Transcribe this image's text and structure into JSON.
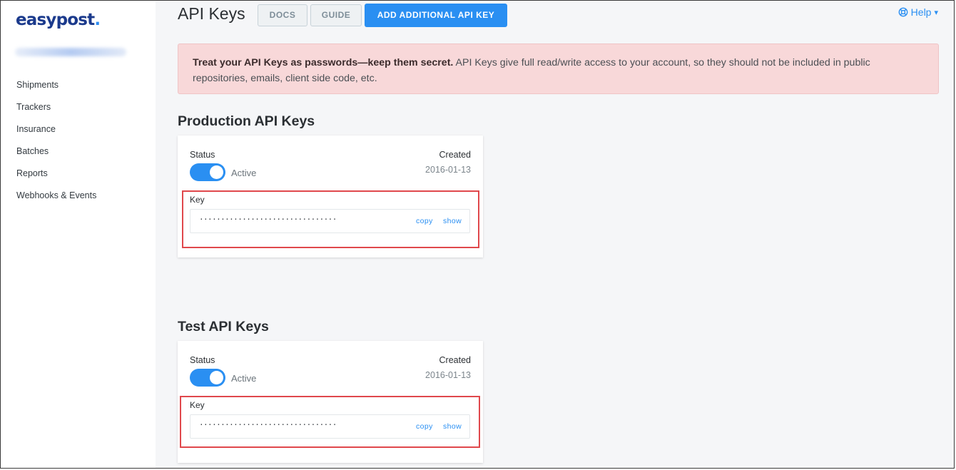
{
  "brand": {
    "logo_text": "easypost",
    "logo_dot": "."
  },
  "sidebar": {
    "items": [
      {
        "label": "Shipments"
      },
      {
        "label": "Trackers"
      },
      {
        "label": "Insurance"
      },
      {
        "label": "Batches"
      },
      {
        "label": "Reports"
      },
      {
        "label": "Webhooks & Events"
      }
    ]
  },
  "header": {
    "title": "API Keys",
    "docs_label": "DOCS",
    "guide_label": "GUIDE",
    "add_label": "ADD ADDITIONAL API KEY",
    "help_label": "Help",
    "help_caret": "▾"
  },
  "alert": {
    "strong": "Treat your API Keys as passwords—keep them secret.",
    "text": " API Keys give full read/write access to your account, so they should not be included in public repositories, emails, client side code, etc."
  },
  "production": {
    "title": "Production API Keys",
    "status_label": "Status",
    "status_value": "Active",
    "toggle_on": true,
    "created_label": "Created",
    "created_date": "2016-01-13",
    "key_label": "Key",
    "key_masked": "································",
    "copy_label": "copy",
    "show_label": "show"
  },
  "test": {
    "title": "Test API Keys",
    "status_label": "Status",
    "status_value": "Active",
    "toggle_on": true,
    "created_label": "Created",
    "created_date": "2016-01-13",
    "key_label": "Key",
    "key_masked": "································",
    "copy_label": "copy",
    "show_label": "show"
  },
  "colors": {
    "accent": "#2a8ff2",
    "brand": "#1b3a8c",
    "alert_bg": "#f8d8d9",
    "highlight": "#e0484c"
  },
  "icons": {
    "help": "lifebuoy-icon",
    "help_caret": "caret-down-icon"
  }
}
